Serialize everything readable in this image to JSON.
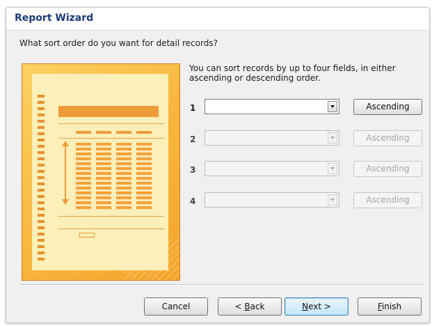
{
  "window": {
    "title": "Report Wizard"
  },
  "question": "What sort order do you want for detail records?",
  "description": "You can sort records by up to four fields, in either ascending or descending order.",
  "sort_rows": [
    {
      "number": "1",
      "field_value": "",
      "order_label": "Ascending",
      "enabled": true
    },
    {
      "number": "2",
      "field_value": "",
      "order_label": "Ascending",
      "enabled": false
    },
    {
      "number": "3",
      "field_value": "",
      "order_label": "Ascending",
      "enabled": false
    },
    {
      "number": "4",
      "field_value": "",
      "order_label": "Ascending",
      "enabled": false
    }
  ],
  "buttons": {
    "cancel": {
      "label": "Cancel"
    },
    "back": {
      "prefix": "< ",
      "mnemonic": "B",
      "rest": "ack"
    },
    "next": {
      "mnemonic": "N",
      "rest": "ext >"
    },
    "finish": {
      "mnemonic": "F",
      "rest": "inish"
    }
  },
  "colors": {
    "accent_orange": "#f8b53d",
    "title_blue": "#1c3c78",
    "default_button_border": "#3c7fb1"
  },
  "icons": {
    "dropdown": "chevron-down-icon",
    "preview": "report-preview-illustration"
  }
}
